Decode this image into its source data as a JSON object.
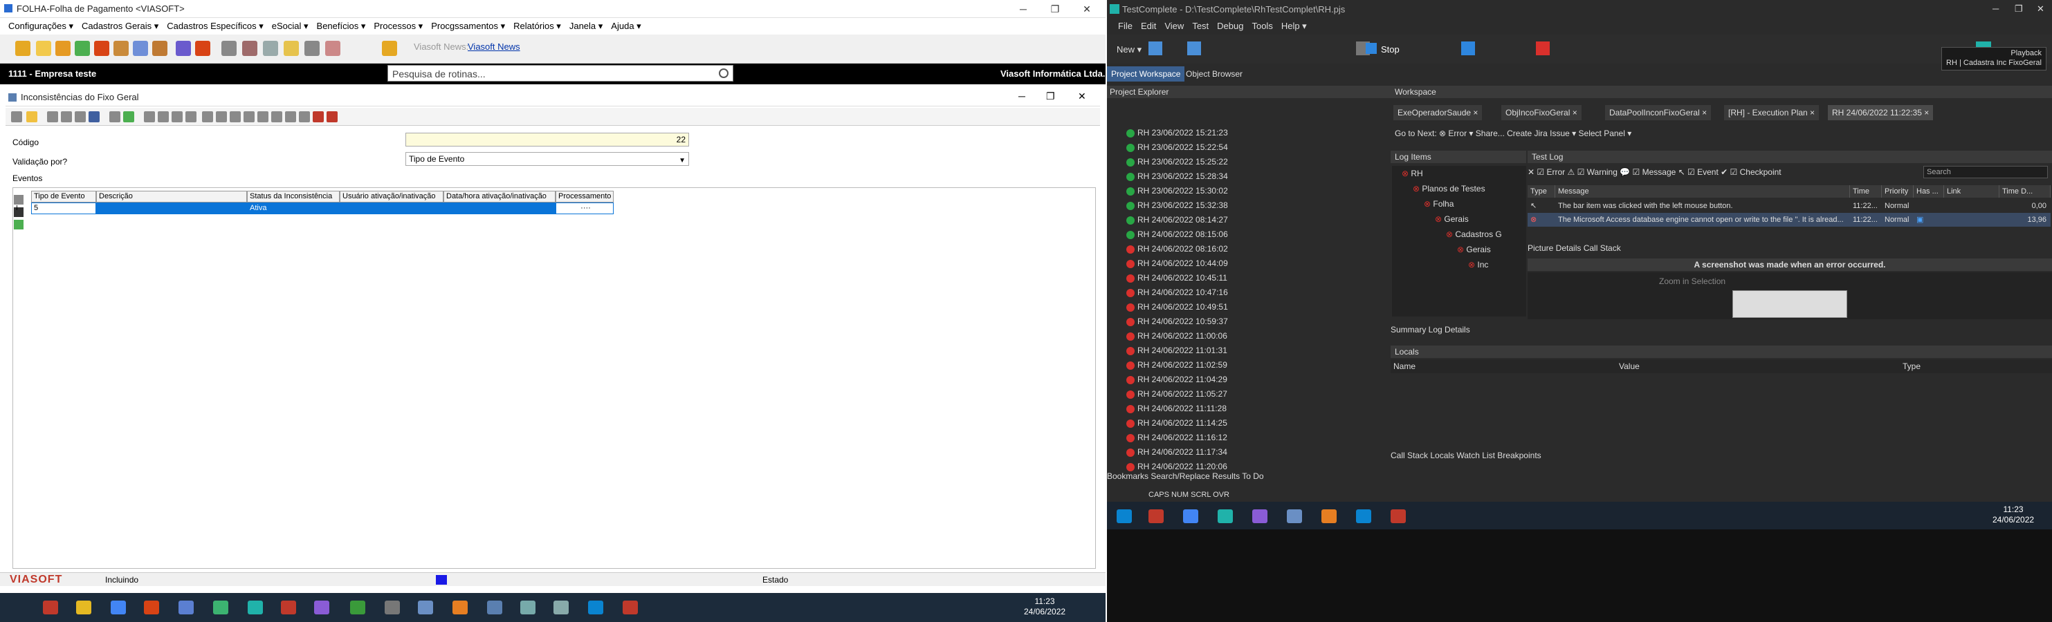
{
  "left": {
    "title": "FOLHA-Folha de Pagamento <VIASOFT>",
    "menu": [
      "Configurações ▾",
      "Cadastros Gerais ▾",
      "Cadastros Específicos ▾",
      "eSocial ▾",
      "Benefícios ▾",
      "Processos ▾",
      "Procgssamentos ▾",
      "Relatórios ▾",
      "Janela ▾",
      "Ajuda ▾"
    ],
    "news_label": "Viasoft News:",
    "news_link": "Viasoft News",
    "company": "1111 - Empresa teste",
    "vendor": "Viasoft Informática Ltda.",
    "search_placeholder": "Pesquisa de rotinas...",
    "form_title": "Inconsistências do Fixo Geral",
    "codigo_label": "Código",
    "codigo_value": "22",
    "validacao_label": "Validação por?",
    "validacao_value": "Tipo de Evento",
    "tab": "Eventos",
    "columns": [
      "Tipo de Evento",
      "Descrição",
      "Status da Inconsistência",
      "Usuário ativação/inativação",
      "Data/hora ativação/inativação",
      "Processamento"
    ],
    "row": {
      "indicator": "I",
      "tipo": "5",
      "descricao": "",
      "status": "Ativa",
      "usuario": "",
      "data": "",
      "proc": "····"
    },
    "logo": "VIASOFT",
    "status_mode": "Incluindo",
    "status_state": "Estado",
    "time": "11:23",
    "date": "24/06/2022"
  },
  "right": {
    "title": "TestComplete - D:\\TestComplete\\RhTestComplet\\RH.pjs",
    "menu": [
      "File",
      "Edit",
      "View",
      "Test",
      "Debug",
      "Tools",
      "Help ▾"
    ],
    "new_label": "New ▾",
    "stop_label": "Stop",
    "playback": "Playback",
    "playback_sub": "RH | Cadastra Inc FixoGeral",
    "tabs": [
      "Project Workspace",
      "Object Browser"
    ],
    "pe_title": "Project Explorer",
    "pe_rows": [
      {
        "t": "RH 23/06/2022 15:21:23",
        "c": "#28a745"
      },
      {
        "t": "RH 23/06/2022 15:22:54",
        "c": "#28a745"
      },
      {
        "t": "RH 23/06/2022 15:25:22",
        "c": "#28a745"
      },
      {
        "t": "RH 23/06/2022 15:28:34",
        "c": "#28a745"
      },
      {
        "t": "RH 23/06/2022 15:30:02",
        "c": "#28a745"
      },
      {
        "t": "RH 23/06/2022 15:32:38",
        "c": "#28a745"
      },
      {
        "t": "RH 24/06/2022 08:14:27",
        "c": "#28a745"
      },
      {
        "t": "RH 24/06/2022 08:15:06",
        "c": "#28a745"
      },
      {
        "t": "RH 24/06/2022 08:16:02",
        "c": "#d9302c"
      },
      {
        "t": "RH 24/06/2022 10:44:09",
        "c": "#d9302c"
      },
      {
        "t": "RH 24/06/2022 10:45:11",
        "c": "#d9302c"
      },
      {
        "t": "RH 24/06/2022 10:47:16",
        "c": "#d9302c"
      },
      {
        "t": "RH 24/06/2022 10:49:51",
        "c": "#d9302c"
      },
      {
        "t": "RH 24/06/2022 10:59:37",
        "c": "#d9302c"
      },
      {
        "t": "RH 24/06/2022 11:00:06",
        "c": "#d9302c"
      },
      {
        "t": "RH 24/06/2022 11:01:31",
        "c": "#d9302c"
      },
      {
        "t": "RH 24/06/2022 11:02:59",
        "c": "#d9302c"
      },
      {
        "t": "RH 24/06/2022 11:04:29",
        "c": "#d9302c"
      },
      {
        "t": "RH 24/06/2022 11:05:27",
        "c": "#d9302c"
      },
      {
        "t": "RH 24/06/2022 11:11:28",
        "c": "#d9302c"
      },
      {
        "t": "RH 24/06/2022 11:14:25",
        "c": "#d9302c"
      },
      {
        "t": "RH 24/06/2022 11:16:12",
        "c": "#d9302c"
      },
      {
        "t": "RH 24/06/2022 11:17:34",
        "c": "#d9302c"
      },
      {
        "t": "RH 24/06/2022 11:20:06",
        "c": "#d9302c"
      }
    ],
    "ws_title": "Workspace",
    "ws_tabs": [
      "ExeOperadorSaude ×",
      "ObjIncoFixoGeral ×",
      "DataPoolInconFixoGeral ×",
      "[RH] - Execution Plan ×",
      "RH 24/06/2022 11:22:35 ×"
    ],
    "ws_toolbar": "Go to Next:  ⊗ Error ▾     Share...   Create Jira Issue ▾        Select Panel ▾",
    "log_items": "Log Items",
    "tree": [
      "RH",
      "Planos de Testes",
      "Folha",
      "Gerais",
      "Cadastros G",
      "Gerais",
      "Inc"
    ],
    "test_log": "Test Log",
    "filters": "✕  ☑ Error   ⚠ ☑ Warning   💬 ☑ Message   ↖ ☑ Event   ✔ ☑ Checkpoint",
    "search": "Search",
    "tl_cols": [
      "Type",
      "Message",
      "Time",
      "Priority",
      "Has ...",
      "Link",
      "Time D..."
    ],
    "tl_rows": [
      {
        "msg": "The bar item was clicked with the left mouse button.",
        "time": "11:22...",
        "pri": "Normal",
        "td": "0,00"
      },
      {
        "msg": "The Microsoft Access database engine cannot open or write to the file ''. It is alread...",
        "time": "11:22...",
        "pri": "Normal",
        "td": "13,96"
      }
    ],
    "subtabs": "Picture   Details   Call Stack",
    "shot_msg": "A screenshot was made when an error occurred.",
    "zoom": "Zoom in Selection",
    "sum_tabs": "Summary   Log Details",
    "locals": "Locals",
    "loc_cols": [
      "Name",
      "Value",
      "Type"
    ],
    "bot_tabs": "Call Stack   Locals   Watch List   Breakpoints",
    "pe_bot": "Bookmarks   Search/Replace Results   To Do",
    "status": "CAPS   NUM   SCRL   OVR",
    "time": "11:23",
    "date": "24/06/2022"
  }
}
